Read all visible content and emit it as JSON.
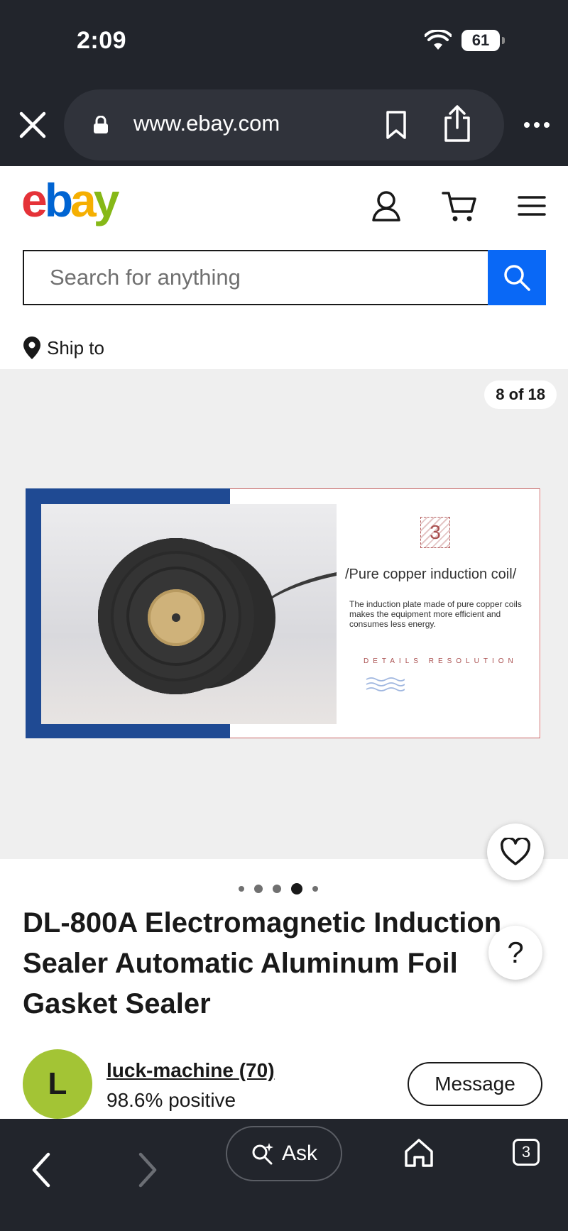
{
  "status_bar": {
    "time": "2:09",
    "battery": "61"
  },
  "browser": {
    "url": "www.ebay.com"
  },
  "header": {
    "logo_letters": [
      "e",
      "b",
      "a",
      "y"
    ],
    "logo_colors": [
      "#e53238",
      "#0064d2",
      "#f5af02",
      "#86b817"
    ]
  },
  "search": {
    "placeholder": "Search for anything"
  },
  "ship_to": {
    "label": "Ship to"
  },
  "gallery": {
    "counter": "8 of 18",
    "image": {
      "step_number": "3",
      "heading": "/Pure copper induction coil/",
      "description": "The induction plate made of pure copper coils makes the equipment more efficient and consumes less energy.",
      "tagline": "DETAILS RESOLUTION"
    },
    "active_dot_index": 3,
    "dot_count": 5
  },
  "listing": {
    "title": "DL-800A Electromagnetic Induction Sealer Automatic Aluminum Foil Gasket Sealer"
  },
  "help": {
    "label": "?"
  },
  "seller": {
    "avatar_letter": "L",
    "name": "luck-machine",
    "count": "(70)",
    "feedback": "98.6% positive",
    "message_label": "Message"
  },
  "toolbar": {
    "ask_label": "Ask",
    "tab_count": "3"
  },
  "colors": {
    "chrome_bg": "#22252c",
    "accent_blue": "#0968f6",
    "avatar_bg": "#a3c435"
  }
}
